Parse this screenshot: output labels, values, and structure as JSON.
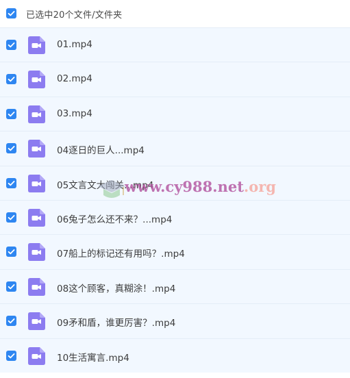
{
  "selection": {
    "label": "已选中20个文件/文件夹",
    "checked": true
  },
  "files": [
    {
      "name": "01.mp4",
      "checked": true,
      "icon": "video-file-icon"
    },
    {
      "name": "02.mp4",
      "checked": true,
      "icon": "video-file-icon"
    },
    {
      "name": "03.mp4",
      "checked": true,
      "icon": "video-file-icon"
    },
    {
      "name": "04逐日的巨人...mp4",
      "checked": true,
      "icon": "video-file-icon"
    },
    {
      "name": "05文言文大闯关...mp4",
      "checked": true,
      "icon": "video-file-icon"
    },
    {
      "name": "06兔子怎么还不来？...mp4",
      "checked": true,
      "icon": "video-file-icon"
    },
    {
      "name": "07船上的标记还有用吗？.mp4",
      "checked": true,
      "icon": "video-file-icon"
    },
    {
      "name": "08这个顾客，真糊涂！.mp4",
      "checked": true,
      "icon": "video-file-icon"
    },
    {
      "name": "09矛和盾，谁更厉害？.mp4",
      "checked": true,
      "icon": "video-file-icon"
    },
    {
      "name": "10生活寓言.mp4",
      "checked": true,
      "icon": "video-file-icon"
    }
  ],
  "watermark": {
    "main": "www.cy988.net",
    "tld": ".org"
  },
  "colors": {
    "checkbox": "#2e86f1",
    "row_background": "#f2f8ff",
    "row_border": "#e4edf7",
    "file_icon": "#8c7cf0"
  }
}
